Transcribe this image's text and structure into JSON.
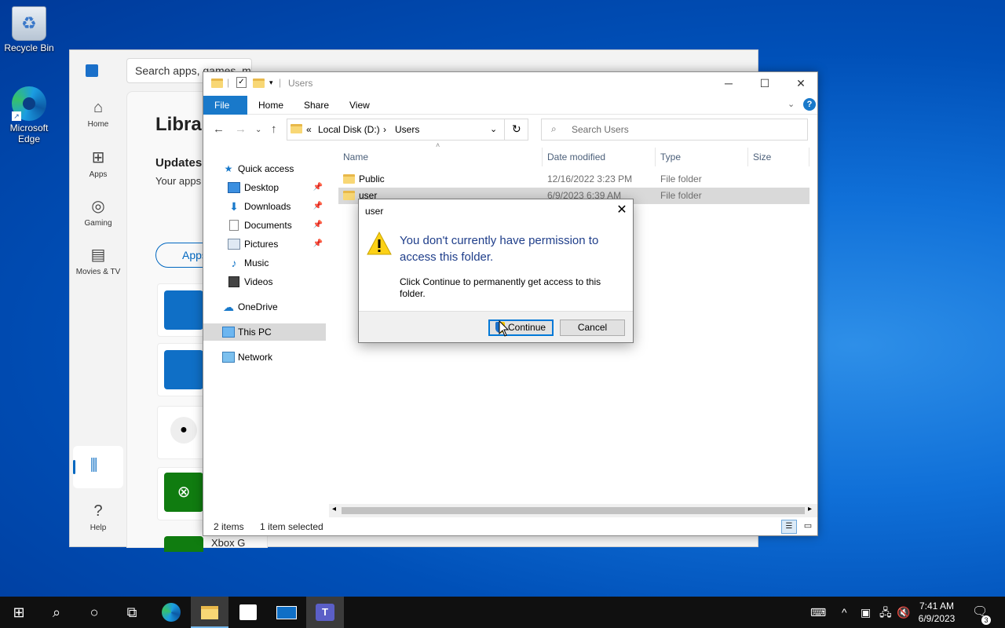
{
  "desktop": {
    "icons": [
      {
        "label": "Recycle Bin"
      },
      {
        "label": "Microsoft Edge"
      }
    ]
  },
  "store": {
    "nav": [
      {
        "label": "Home",
        "icon": "home-icon"
      },
      {
        "label": "Apps",
        "icon": "apps-icon"
      },
      {
        "label": "Gaming",
        "icon": "gaming-icon"
      },
      {
        "label": "Movies & TV",
        "icon": "movies-icon"
      },
      {
        "label": "Help",
        "icon": "help-icon"
      }
    ],
    "search_placeholder": "Search apps, games, m",
    "heading": "Librar",
    "updates_title": "Updates",
    "updates_sub": "Your apps",
    "apps_button": "Apps",
    "bottom_text": "Xbox G"
  },
  "explorer": {
    "title": "Users",
    "ribbon_tabs": [
      "File",
      "Home",
      "Share",
      "View"
    ],
    "breadcrumb": {
      "prefix": "«",
      "parent": "Local Disk (D:)",
      "sep": "›",
      "current": "Users"
    },
    "search_placeholder": "Search Users",
    "nav": [
      {
        "label": "Quick access",
        "icon": "star-icon"
      },
      {
        "label": "Desktop",
        "icon": "desktop-icon",
        "pinned": true
      },
      {
        "label": "Downloads",
        "icon": "downloads-icon",
        "pinned": true
      },
      {
        "label": "Documents",
        "icon": "documents-icon",
        "pinned": true
      },
      {
        "label": "Pictures",
        "icon": "pictures-icon",
        "pinned": true
      },
      {
        "label": "Music",
        "icon": "music-icon"
      },
      {
        "label": "Videos",
        "icon": "videos-icon"
      },
      {
        "label": "OneDrive",
        "icon": "onedrive-icon"
      },
      {
        "label": "This PC",
        "icon": "pc-icon",
        "selected": true
      },
      {
        "label": "Network",
        "icon": "network-icon"
      }
    ],
    "columns": [
      "Name",
      "Date modified",
      "Type",
      "Size"
    ],
    "rows": [
      {
        "name": "Public",
        "date": "12/16/2022 3:23 PM",
        "type": "File folder",
        "size": ""
      },
      {
        "name": "user",
        "date": "6/9/2023 6:39 AM",
        "type": "File folder",
        "size": "",
        "selected": true
      }
    ],
    "status_items": "2 items",
    "status_selected": "1 item selected"
  },
  "dialog": {
    "title": "user",
    "message": "You don't currently have permission to access this folder.",
    "detail": "Click Continue to permanently get access to this folder.",
    "continue_label": "Continue",
    "cancel_label": "Cancel"
  },
  "taskbar": {
    "time": "7:41 AM",
    "date": "6/9/2023",
    "notification_count": "3",
    "accent": "#76b9ed"
  }
}
